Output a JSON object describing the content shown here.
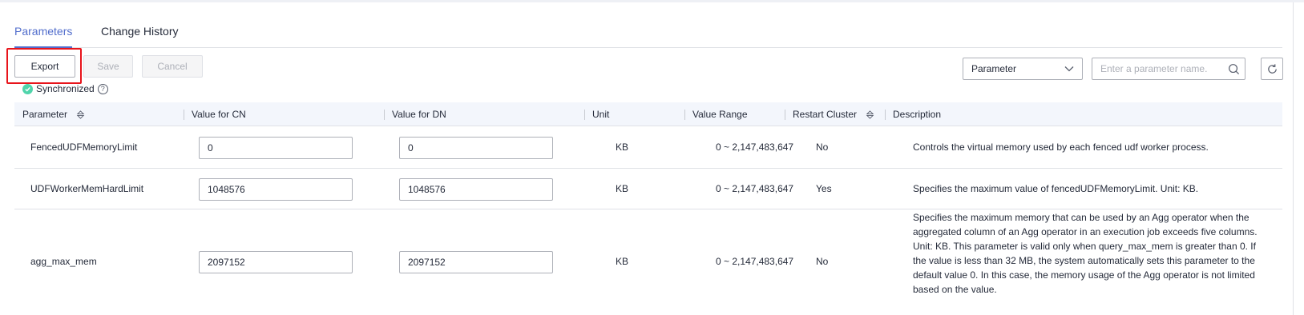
{
  "tabs": [
    {
      "label": "Parameters",
      "active": true
    },
    {
      "label": "Change History",
      "active": false
    }
  ],
  "toolbar": {
    "export_label": "Export",
    "save_label": "Save",
    "cancel_label": "Cancel",
    "status_text": "Synchronized",
    "filter_select": "Parameter",
    "search_placeholder": "Enter a parameter name."
  },
  "table": {
    "headers": [
      "Parameter",
      "Value for CN",
      "Value for DN",
      "Unit",
      "Value Range",
      "Restart Cluster",
      "Description"
    ],
    "rows": [
      {
        "parameter": "FencedUDFMemoryLimit",
        "value_cn": "0",
        "value_dn": "0",
        "unit": "KB",
        "range": "0 ~ 2,147,483,647",
        "restart": "No",
        "description": "Controls the virtual memory used by each fenced udf worker process."
      },
      {
        "parameter": "UDFWorkerMemHardLimit",
        "value_cn": "1048576",
        "value_dn": "1048576",
        "unit": "KB",
        "range": "0 ~ 2,147,483,647",
        "restart": "Yes",
        "description": "Specifies the maximum value of fencedUDFMemoryLimit. Unit: KB."
      },
      {
        "parameter": "agg_max_mem",
        "value_cn": "2097152",
        "value_dn": "2097152",
        "unit": "KB",
        "range": "0 ~ 2,147,483,647",
        "restart": "No",
        "description": "Specifies the maximum memory that can be used by an Agg operator when the aggregated column of an Agg operator in an execution job exceeds five columns. Unit: KB. This parameter is valid only when query_max_mem is greater than 0. If the value is less than 32 MB, the system automatically sets this parameter to the default value 0. In this case, the memory usage of the Agg operator is not limited based on the value."
      }
    ]
  },
  "colors": {
    "accent": "#526ecc",
    "highlight": "#e8141b",
    "success": "#50d4ab",
    "header_bg": "#f3f6fc"
  },
  "icons": [
    "check-circle-icon",
    "help-icon",
    "chevron-down-icon",
    "search-icon",
    "refresh-icon",
    "sort-icon"
  ]
}
